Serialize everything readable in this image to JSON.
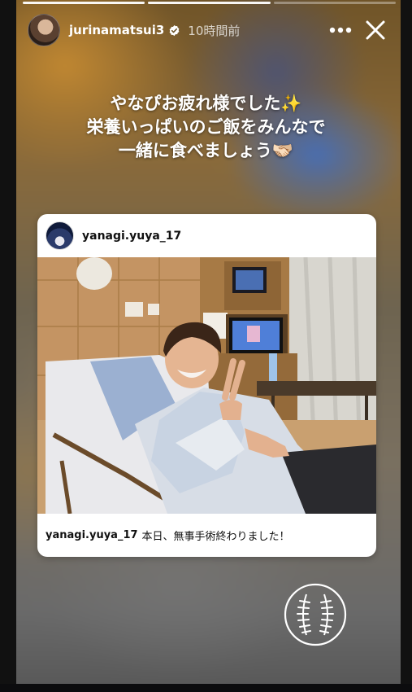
{
  "story": {
    "progress": {
      "segments_total": 3,
      "current_segment": 2
    },
    "author": {
      "username": "jurinamatsui3",
      "verified": true,
      "time_ago": "10時間前"
    },
    "caption_lines": [
      {
        "text": "やなぴお疲れ様でした",
        "emoji": "✨"
      },
      {
        "text": "栄養いっぱいのご飯をみんなで",
        "emoji": ""
      },
      {
        "text": "一緒に食べましょう",
        "emoji": "🫱🏻‍🫲🏼"
      }
    ],
    "shared_post": {
      "username": "yanagi.yuya_17",
      "caption_user": "yanagi.yuya_17",
      "caption_text": "本日、無事手術終わりました！"
    },
    "icons": {
      "more": "more-horizontal-icon",
      "close": "close-icon",
      "verified": "verified-badge-icon",
      "sticker": "baseball-icon"
    },
    "colors": {
      "verified_badge": "#ffffff",
      "card_background": "#ffffff"
    }
  }
}
